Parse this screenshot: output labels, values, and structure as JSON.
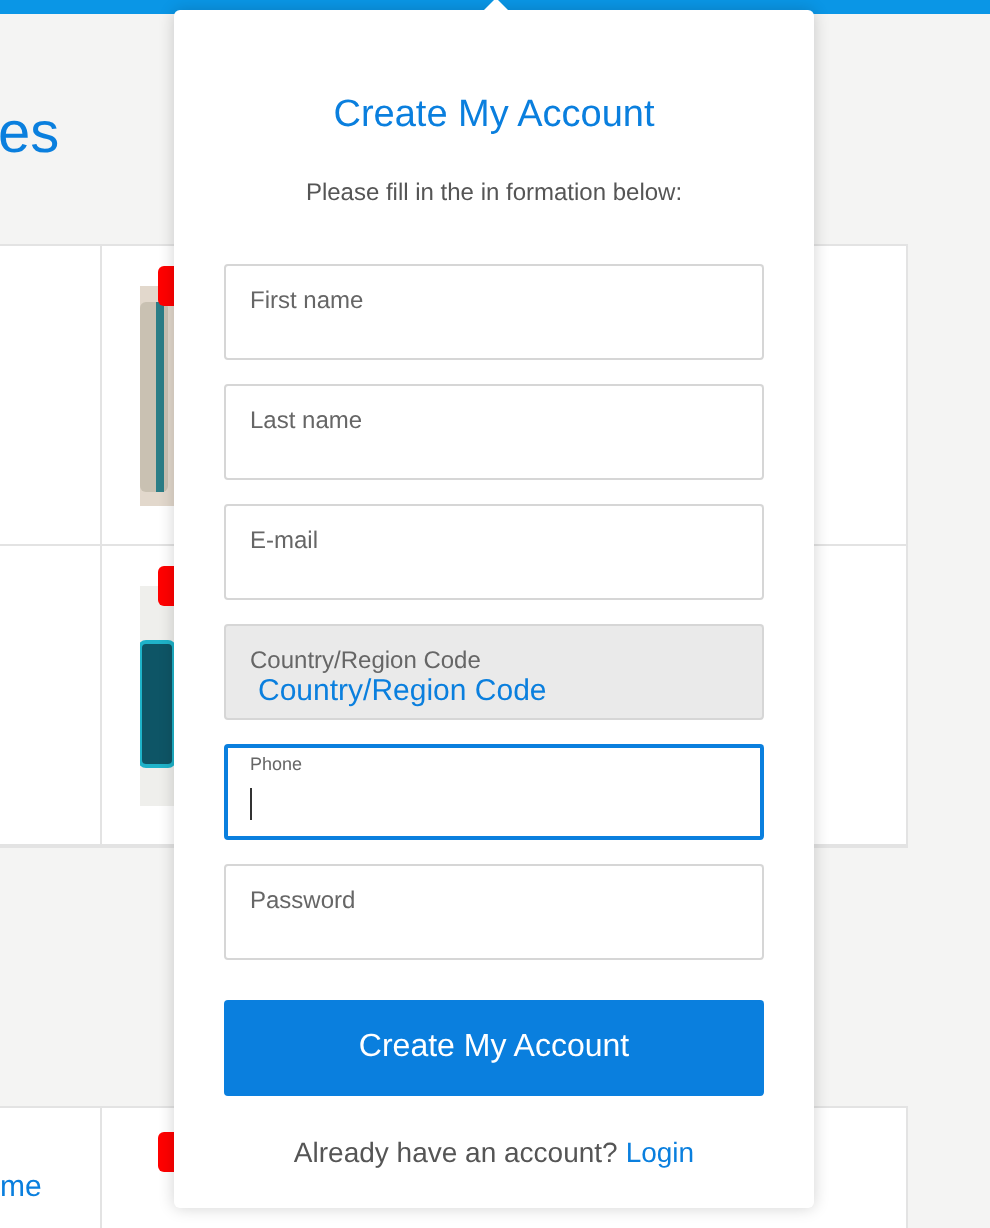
{
  "page": {
    "heading": "es",
    "bottom_row": {
      "link": "me"
    }
  },
  "popup": {
    "title": "Create My Account",
    "subtitle": "Please fill in the in formation below:",
    "fields": [
      {
        "kind": "input",
        "placeholder": "First name",
        "focused": false
      },
      {
        "kind": "input",
        "placeholder": "Last name",
        "focused": false
      },
      {
        "kind": "input",
        "placeholder": "E-mail",
        "focused": false
      },
      {
        "kind": "select",
        "label": "Country/Region Code",
        "value": "Country/Region Code",
        "focused": false
      },
      {
        "kind": "input",
        "placeholder": "Phone",
        "focused": true
      },
      {
        "kind": "input",
        "placeholder": "Password",
        "focused": false
      }
    ],
    "submit": "Create My Account",
    "footer_text": "Already have an account?",
    "footer_link": "Login"
  }
}
